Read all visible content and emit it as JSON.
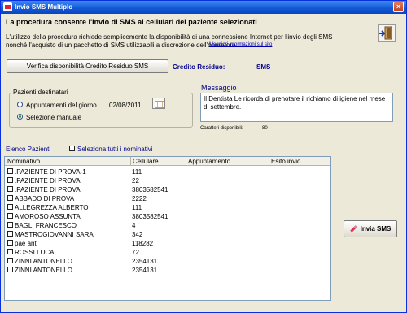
{
  "window": {
    "title": "Invio SMS Multiplo",
    "close_label": "×"
  },
  "header": {
    "headline": "La procedura consente l'invio di SMS ai cellulari dei paziente selezionati",
    "desc_line1": "L'utilizzo della procedura richiede semplicemente la disponibilità di una connessione Internet per l'invio degli SMS",
    "desc_line2": "nonché l'acquisto di un pacchetto di SMS utilizzabili a discrezione dell'operatore.",
    "more_link": "Maggiori informazioni sul sito"
  },
  "credit": {
    "verify_button": "Verifica disponibilità Credito Residuo SMS",
    "label": "Credito Residuo:",
    "value": "SMS"
  },
  "recipients": {
    "group_title": "Pazienti destinatari",
    "option_appointments": "Appuntamenti del giorno",
    "date": "02/08/2011",
    "option_manual": "Selezione manuale",
    "selected": "manual"
  },
  "message": {
    "label": "Messaggio",
    "text": "Il Dentista Le ricorda di prenotare il richiamo di igiene nel mese di settembre.",
    "chars_label": "Caratteri disponibili:",
    "chars_value": "80"
  },
  "patients": {
    "list_label": "Elenco Pazienti",
    "select_all": "Seleziona tutti i nominativi",
    "columns": [
      "Nominativo",
      "Cellulare",
      "Appuntamento",
      "Esito invio"
    ],
    "rows": [
      {
        "name": ".PAZIENTE DI PROVA-1",
        "phone": "111"
      },
      {
        "name": ".PAZIENTE DI PROVA",
        "phone": "22"
      },
      {
        "name": ".PAZIENTE DI PROVA",
        "phone": "3803582541"
      },
      {
        "name": "ABBADO DI PROVA",
        "phone": "2222"
      },
      {
        "name": "ALLEGREZZA ALBERTO",
        "phone": "111"
      },
      {
        "name": "AMOROSO ASSUNTA",
        "phone": "3803582541"
      },
      {
        "name": "BAGLI FRANCESCO",
        "phone": "4"
      },
      {
        "name": "MASTROGIOVANNI SARA",
        "phone": "342"
      },
      {
        "name": "pae ant",
        "phone": "118282"
      },
      {
        "name": "ROSSI LUCA",
        "phone": "72"
      },
      {
        "name": "ZINNI ANTONELLO",
        "phone": "2354131"
      },
      {
        "name": "ZINNI ANTONELLO",
        "phone": "2354131"
      }
    ]
  },
  "actions": {
    "send_button": "Invia SMS"
  },
  "icons": {
    "exit": "exit-door-icon",
    "calendar": "calendar-icon",
    "send": "pencil-icon",
    "app": "app-icon"
  },
  "colors": {
    "titlebar": "#1458d6",
    "accent_text": "#00008b",
    "window_bg": "#ece9d8"
  }
}
